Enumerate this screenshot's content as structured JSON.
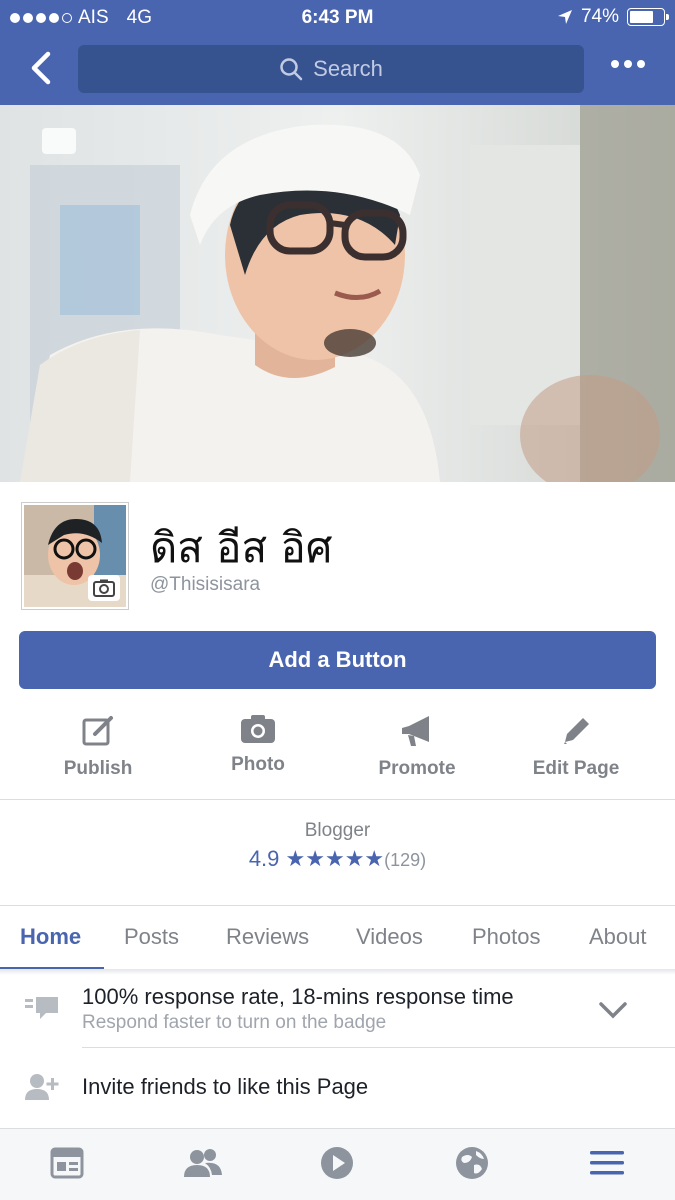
{
  "status_bar": {
    "carrier": "AIS",
    "network": "4G",
    "time": "6:43 PM",
    "battery": "74%",
    "battery_level": 0.74
  },
  "header": {
    "search_placeholder": "Search"
  },
  "profile": {
    "name": "ดิส อีส อิศ",
    "username": "@Thisisisara",
    "add_button_label": "Add a Button"
  },
  "actions": [
    {
      "label": "Publish",
      "icon": "edit-icon"
    },
    {
      "label": "Photo",
      "icon": "camera-icon"
    },
    {
      "label": "Promote",
      "icon": "megaphone-icon"
    },
    {
      "label": "Edit Page",
      "icon": "pencil-icon"
    }
  ],
  "info": {
    "category": "Blogger",
    "rating": "4.9",
    "stars": "★★★★★",
    "review_count": "(129)"
  },
  "tabs": [
    "Home",
    "Posts",
    "Reviews",
    "Videos",
    "Photos",
    "About"
  ],
  "active_tab": "Home",
  "response_row": {
    "title": "100% response rate, 18-mins response time",
    "subtitle": "Respond faster to turn on the badge"
  },
  "invite_row": {
    "title": "Invite friends to like this Page"
  },
  "tab_bar": [
    "news-feed-icon",
    "friends-icon",
    "video-icon",
    "globe-icon",
    "menu-icon"
  ],
  "colors": {
    "brand": "#4a65b0",
    "header_search": "#37538f",
    "muted_text": "#7f8389"
  }
}
